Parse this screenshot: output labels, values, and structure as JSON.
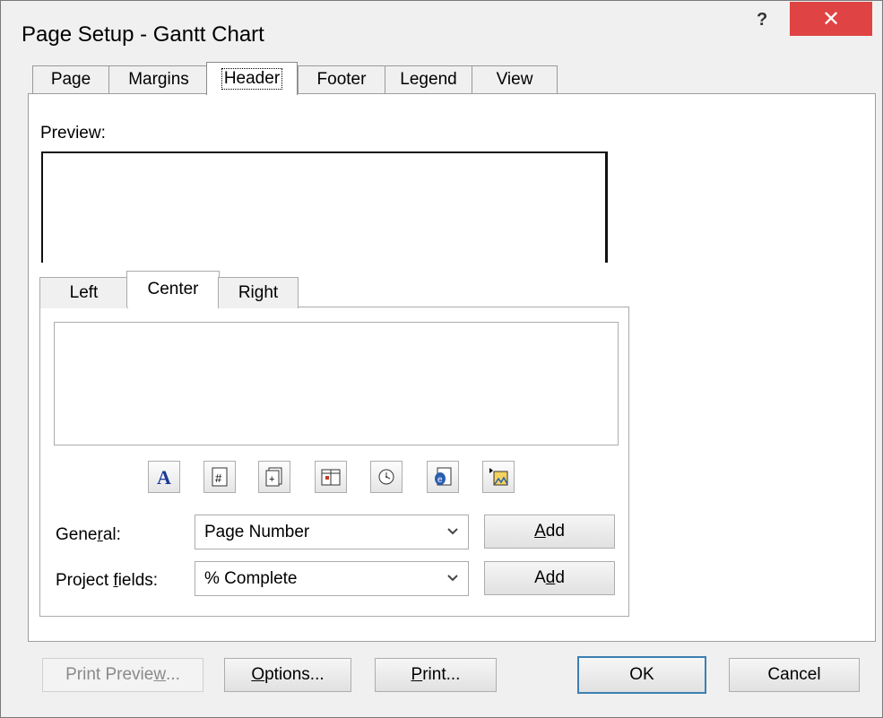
{
  "window": {
    "title": "Page Setup - Gantt Chart",
    "help": "?",
    "close": "✕"
  },
  "tabs": [
    "Page",
    "Margins",
    "Header",
    "Footer",
    "Legend",
    "View"
  ],
  "preview_label": "Preview:",
  "subtabs": [
    "Left",
    "Center",
    "Right"
  ],
  "toolbar_icons": [
    "font-icon",
    "page-number-icon",
    "total-pages-icon",
    "date-icon",
    "time-icon",
    "file-name-icon",
    "insert-picture-icon"
  ],
  "general": {
    "label_a": "Gene",
    "label_u": "r",
    "label_b": "al:",
    "value": "Page Number",
    "add_a": "",
    "add_u": "A",
    "add_b": "dd"
  },
  "project": {
    "label_a": "Project ",
    "label_u": "f",
    "label_b": "ields:",
    "value": "% Complete",
    "add_a": "A",
    "add_u": "d",
    "add_b": "d"
  },
  "footer": {
    "print_preview_a": "Print Previe",
    "print_preview_u": "w",
    "print_preview_b": "...",
    "options_u": "O",
    "options_b": "ptions...",
    "print_u": "P",
    "print_b": "rint...",
    "ok": "OK",
    "cancel": "Cancel"
  }
}
